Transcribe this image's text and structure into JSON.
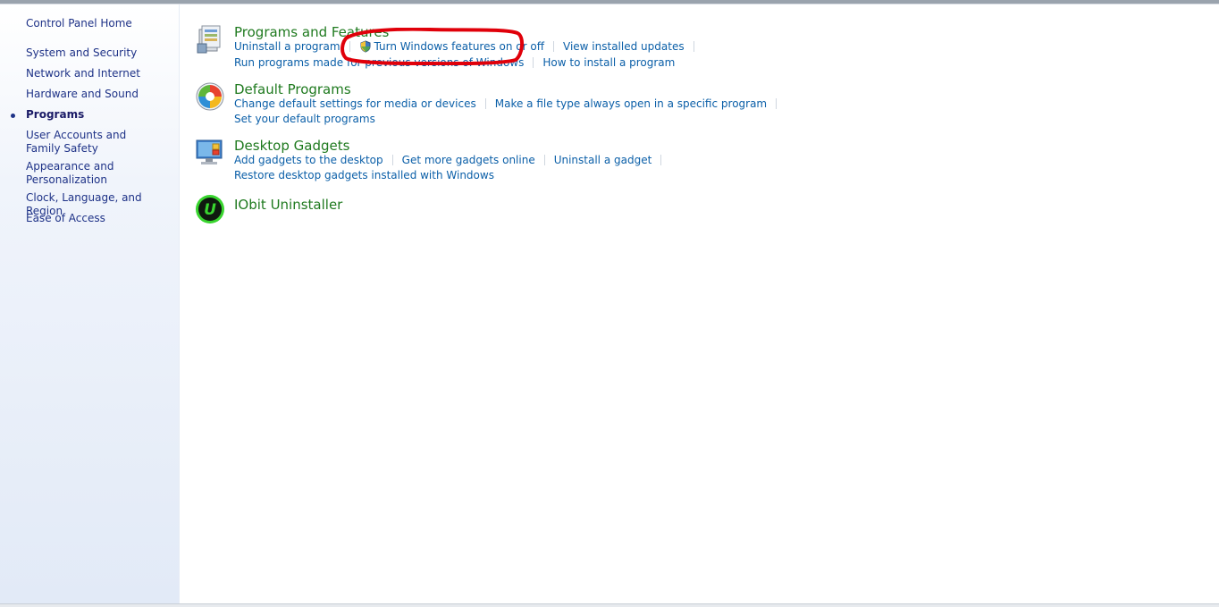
{
  "sidebar": {
    "home": "Control Panel Home",
    "items": [
      {
        "label": "System and Security"
      },
      {
        "label": "Network and Internet"
      },
      {
        "label": "Hardware and Sound"
      },
      {
        "label": "Programs",
        "current": true
      },
      {
        "label": "User Accounts and Family Safety"
      },
      {
        "label": "Appearance and Personalization"
      },
      {
        "label": "Clock, Language, and Region"
      },
      {
        "label": "Ease of Access"
      }
    ]
  },
  "categories": [
    {
      "title": "Programs and Features",
      "icon": "programs-features-icon",
      "row1": [
        "Uninstall a program",
        "Turn Windows features on or off",
        "View installed updates"
      ],
      "row2": [
        "Run programs made for previous versions of Windows",
        "How to install a program"
      ]
    },
    {
      "title": "Default Programs",
      "icon": "default-programs-icon",
      "row1": [
        "Change default settings for media or devices",
        "Make a file type always open in a specific program"
      ],
      "row2": [
        "Set your default programs"
      ]
    },
    {
      "title": "Desktop Gadgets",
      "icon": "desktop-gadgets-icon",
      "row1": [
        "Add gadgets to the desktop",
        "Get more gadgets online",
        "Uninstall a gadget"
      ],
      "row2": [
        "Restore desktop gadgets installed with Windows"
      ]
    },
    {
      "title": "IObit Uninstaller",
      "icon": "iobit-uninstaller-icon"
    }
  ],
  "annotation": {
    "color": "#e0000a"
  },
  "colors": {
    "category_title": "#1f7a1f",
    "link": "#0b5fa8",
    "sidebar_link": "#1e3287"
  }
}
